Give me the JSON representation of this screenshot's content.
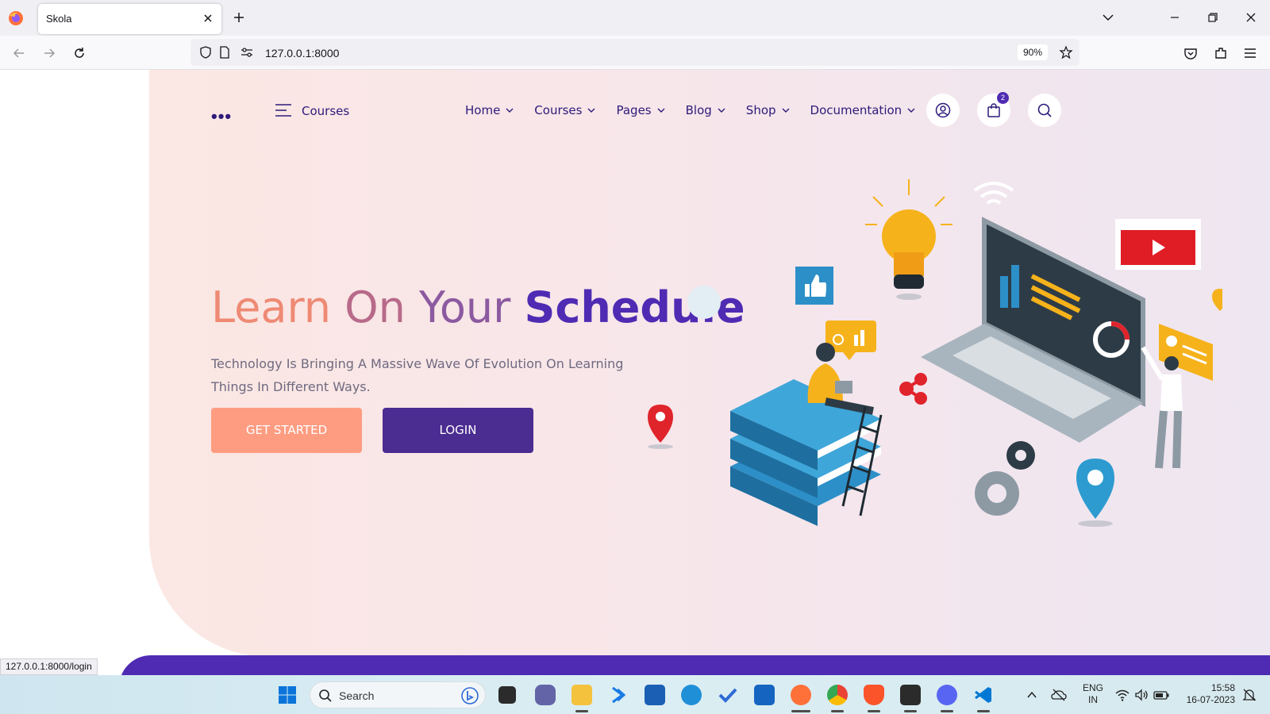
{
  "browser": {
    "tab_title": "Skola",
    "url": "127.0.0.1:8000",
    "zoom": "90%",
    "status_url": "127.0.0.1:8000/login"
  },
  "header": {
    "categories_label": "Courses",
    "menu": [
      {
        "label": "Home"
      },
      {
        "label": "Courses"
      },
      {
        "label": "Pages"
      },
      {
        "label": "Blog"
      },
      {
        "label": "Shop"
      },
      {
        "label": "Documentation"
      }
    ],
    "cart_count": "2"
  },
  "hero": {
    "headline_parts": [
      "Learn ",
      "On ",
      "Your ",
      "Schedule"
    ],
    "subtitle": "Technology Is Bringing A Massive Wave Of Evolution On Learning Things In Different Ways.",
    "get_started_label": "GET STARTED",
    "login_label": "LOGIN"
  },
  "taskbar": {
    "search_placeholder": "Search",
    "lang_line1": "ENG",
    "lang_line2": "IN",
    "time": "15:58",
    "date": "16-07-2023"
  },
  "colors": {
    "brand_purple": "#4f2bb3",
    "login_button": "#4b2c91",
    "get_started_button": "#fd9c81"
  }
}
